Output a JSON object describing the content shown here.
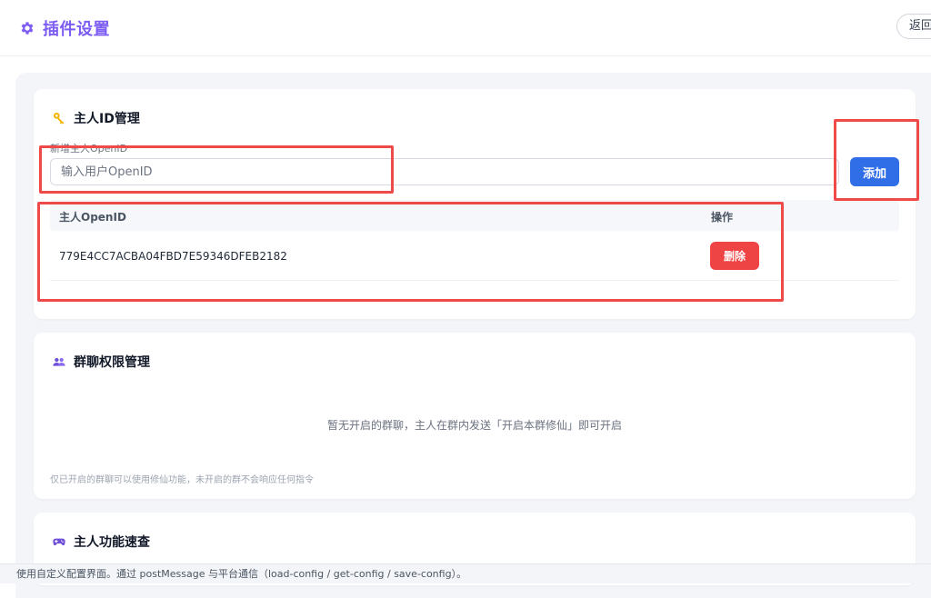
{
  "header": {
    "title": "插件设置",
    "back_label": "返回"
  },
  "owner_card": {
    "title": "主人ID管理",
    "field_label": "新增主人OpenID",
    "input_placeholder": "输入用户OpenID",
    "input_value": "",
    "add_label": "添加",
    "columns": [
      "主人OpenID",
      "操作"
    ],
    "rows": [
      {
        "openid": "779E4CC7ACBA04FBD7E59346DFEB2182",
        "action": "删除"
      }
    ],
    "hint": ""
  },
  "group_card": {
    "title": "群聊权限管理",
    "empty_message": "暂无开启的群聊，主人在群内发送「开启本群修仙」即可开启",
    "hint": "仅已开启的群聊可以使用修仙功能，未开启的群不会响应任何指令"
  },
  "quick_card": {
    "title": "主人功能速查"
  },
  "footer": {
    "note": "使用自定义配置界面。通过 postMessage 与平台通信（load-config / get-config / save-config）。"
  },
  "icons": {
    "title": "gear-icon",
    "owner": "key-icon",
    "group": "users-icon",
    "quick": "gamepad-icon"
  },
  "colors": {
    "accent": "#7c5cf2",
    "primary": "#2f6ee6",
    "danger": "#ef4444",
    "highlight": "#ef4a4a"
  }
}
